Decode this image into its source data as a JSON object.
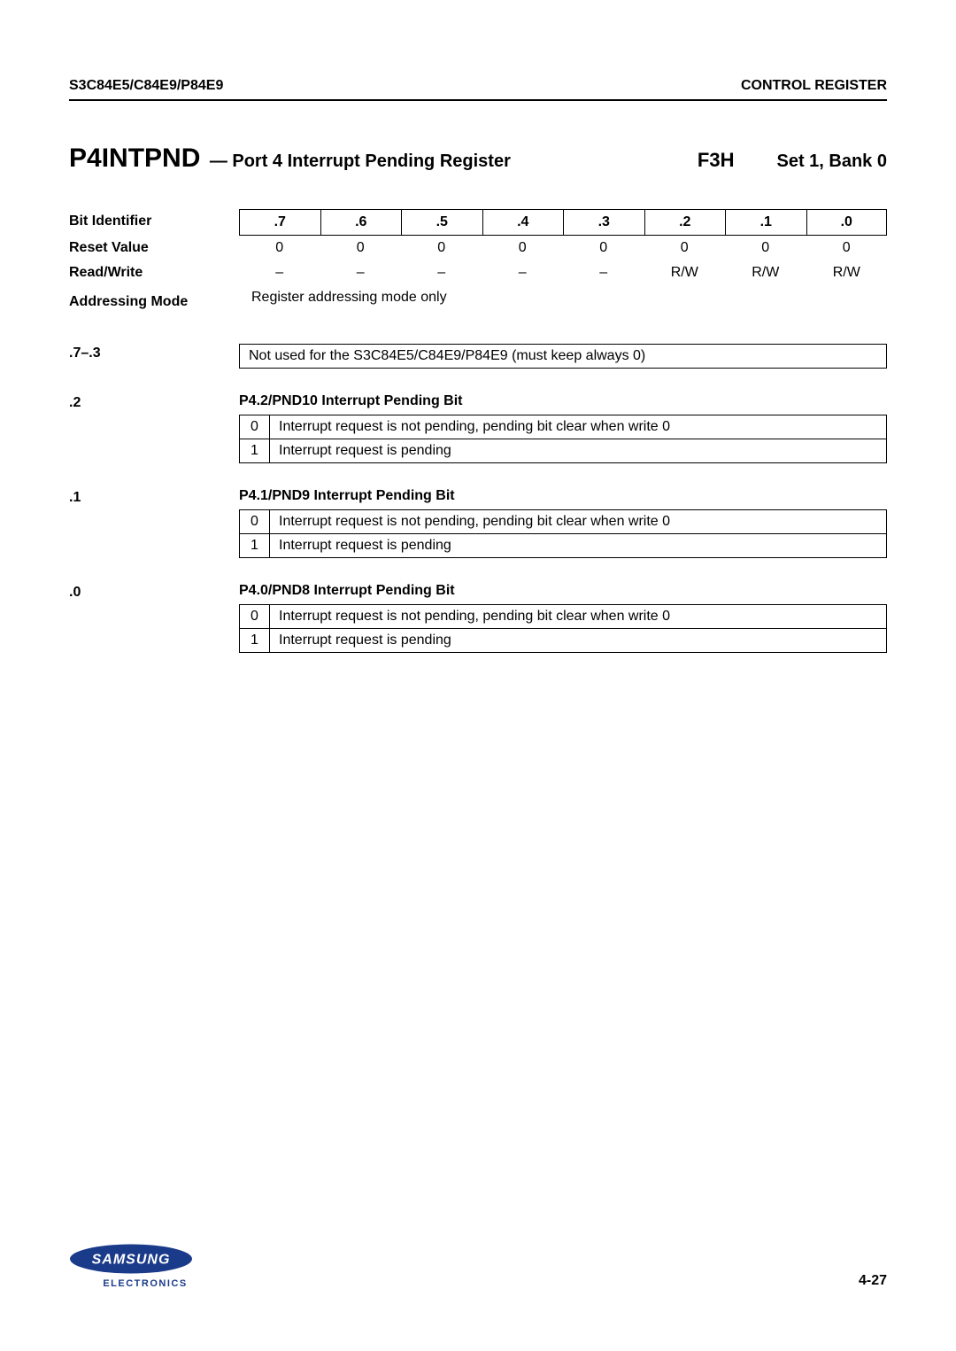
{
  "header": {
    "left": "S3C84E5/C84E9/P84E9",
    "right": "CONTROL REGISTER"
  },
  "title": {
    "name": "P4INTPND",
    "desc": "— Port 4 Interrupt Pending Register",
    "addr": "F3H",
    "set": "Set 1, Bank 0"
  },
  "rows": {
    "bit_identifier_label": "Bit Identifier",
    "bits": [
      ".7",
      ".6",
      ".5",
      ".4",
      ".3",
      ".2",
      ".1",
      ".0"
    ],
    "reset_label": "Reset Value",
    "reset_values": [
      "0",
      "0",
      "0",
      "0",
      "0",
      "0",
      "0",
      "0"
    ],
    "rw_label": "Read/Write",
    "rw_values": [
      "–",
      "–",
      "–",
      "–",
      "–",
      "R/W",
      "R/W",
      "R/W"
    ],
    "addr_mode_label": "Addressing Mode",
    "addr_mode_text": "Register addressing mode only"
  },
  "sections": [
    {
      "label": ".7–.3",
      "single": "Not used for the S3C84E5/C84E9/P84E9 (must keep always 0)"
    },
    {
      "label": ".2",
      "title": "P4.2/PND10 Interrupt Pending Bit",
      "table": [
        {
          "v": "0",
          "d": "Interrupt request is not pending, pending bit clear when write 0"
        },
        {
          "v": "1",
          "d": "Interrupt request is pending"
        }
      ]
    },
    {
      "label": ".1",
      "title": "P4.1/PND9 Interrupt Pending Bit",
      "table": [
        {
          "v": "0",
          "d": "Interrupt request is not pending, pending bit clear when write 0"
        },
        {
          "v": "1",
          "d": "Interrupt request is pending"
        }
      ]
    },
    {
      "label": ".0",
      "title": "P4.0/PND8 Interrupt Pending Bit",
      "table": [
        {
          "v": "0",
          "d": "Interrupt request is not pending, pending bit clear when write 0"
        },
        {
          "v": "1",
          "d": "Interrupt request is pending"
        }
      ]
    }
  ],
  "footer": {
    "electronics": "ELECTRONICS",
    "page": "4-27"
  }
}
